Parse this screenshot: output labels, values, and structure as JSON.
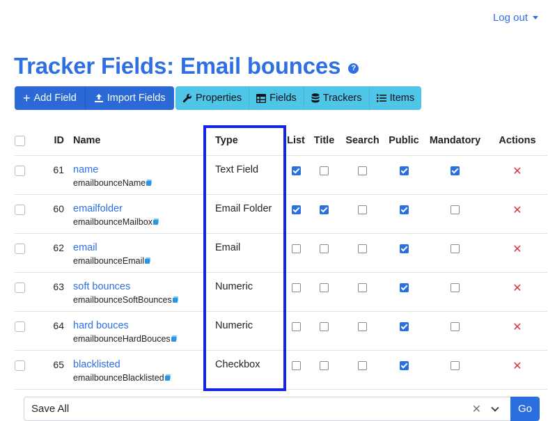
{
  "header": {
    "logout_label": "Log out"
  },
  "page": {
    "title": "Tracker Fields: Email bounces",
    "help_glyph": "?"
  },
  "toolbar": {
    "add_field": "Add Field",
    "import_fields": "Import Fields",
    "properties": "Properties",
    "fields": "Fields",
    "trackers": "Trackers",
    "items": "Items"
  },
  "table": {
    "headers": {
      "id": "ID",
      "name": "Name",
      "type": "Type",
      "list": "List",
      "title": "Title",
      "search": "Search",
      "public": "Public",
      "mandatory": "Mandatory",
      "actions": "Actions"
    },
    "rows": [
      {
        "id": "61",
        "name": "name",
        "perm": "emailbounceName",
        "type": "Text Field",
        "list": true,
        "title": false,
        "search": false,
        "public": true,
        "mandatory": true
      },
      {
        "id": "60",
        "name": "emailfolder",
        "perm": "emailbounceMailbox",
        "type": "Email Folder",
        "list": true,
        "title": true,
        "search": false,
        "public": true,
        "mandatory": false
      },
      {
        "id": "62",
        "name": "email",
        "perm": "emailbounceEmail",
        "type": "Email",
        "list": false,
        "title": false,
        "search": false,
        "public": true,
        "mandatory": false
      },
      {
        "id": "63",
        "name": "soft bounces",
        "perm": "emailbounceSoftBounces",
        "type": "Numeric",
        "list": false,
        "title": false,
        "search": false,
        "public": true,
        "mandatory": false
      },
      {
        "id": "64",
        "name": "hard bouces",
        "perm": "emailbounceHardBouces",
        "type": "Numeric",
        "list": false,
        "title": false,
        "search": false,
        "public": true,
        "mandatory": false
      },
      {
        "id": "65",
        "name": "blacklisted",
        "perm": "emailbounceBlacklisted",
        "type": "Checkbox",
        "list": false,
        "title": false,
        "search": false,
        "public": true,
        "mandatory": false
      }
    ],
    "delete_glyph": "✕"
  },
  "bulk": {
    "selected": "Save All",
    "clear_glyph": "✕",
    "go_label": "Go"
  },
  "colors": {
    "accent": "#2f6fe4",
    "info": "#4fc6e8",
    "danger": "#dc3545",
    "highlight": "#1224e6"
  }
}
